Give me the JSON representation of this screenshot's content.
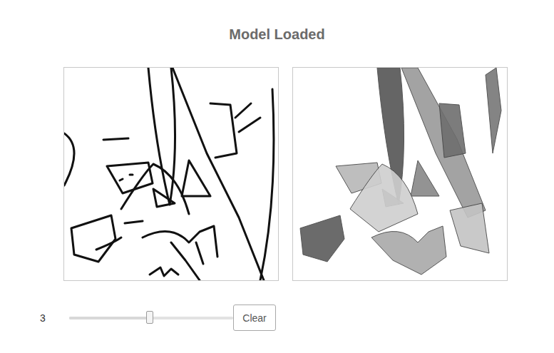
{
  "title": "Model Loaded",
  "slider": {
    "value": "3",
    "level": 0.49
  },
  "button": "Clear"
}
